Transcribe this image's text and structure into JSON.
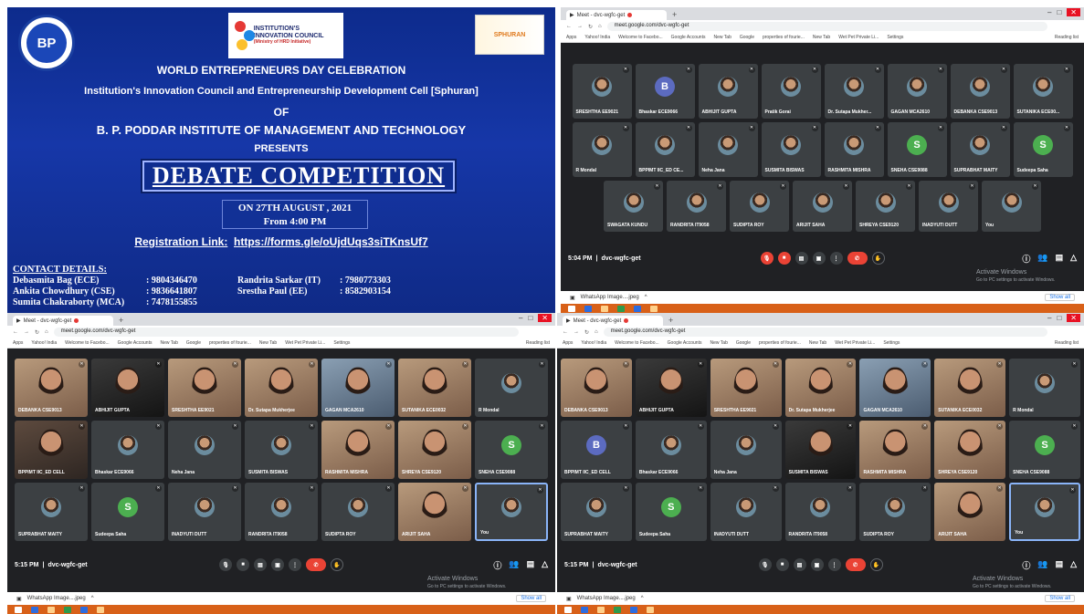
{
  "poster": {
    "bp_logo_text": "BP",
    "bp_logo_sub": "PODDAR",
    "iic_logo_text": "INSTITUTION'S INNOVATION COUNCIL",
    "iic_logo_sub": "(Ministry of HRD Initiative)",
    "sphuran_logo_text": "SPHURAN",
    "line1": "WORLD ENTREPRENEURS DAY CELEBRATION",
    "line2": "Institution's Innovation Council and Entrepreneurship Development Cell [Sphuran]",
    "line3": "OF",
    "line4": "B. P. PODDAR INSTITUTE OF MANAGEMENT AND TECHNOLOGY",
    "line5": "PRESENTS",
    "title": "DEBATE COMPETITION",
    "date": "ON 27TH AUGUST , 2021",
    "time": "From 4:00 PM",
    "reg_label": "Registration Link:",
    "reg_link": "https://forms.gle/oUjdUqs3siTKnsUf7",
    "contacts_heading": "CONTACT DETAILS:",
    "contacts": [
      {
        "name": "Debasmita Bag (ECE)",
        "phone": ": 9804346470",
        "name2": "Randrita Sarkar (IT)",
        "phone2": ": 7980773303"
      },
      {
        "name": "Ankita Chowdhury (CSE)",
        "phone": ": 9836641807",
        "name2": "Srestha Paul (EE)",
        "phone2": ": 8582903154"
      },
      {
        "name": "Sumita Chakraborty (MCA)",
        "phone": ": 7478155855",
        "name2": "",
        "phone2": ""
      }
    ]
  },
  "browser": {
    "tab_title": "Meet - dvc-wgfc-get",
    "url": "meet.google.com/dvc-wgfc-get",
    "bookmarks": [
      "Apps",
      "Yahoo! India",
      "Welcome to Facebo...",
      "Google Accounts",
      "New Tab",
      "Google",
      "properties of fourie...",
      "New Tab",
      "Wet Pet Private Li...",
      "Settings"
    ],
    "reading_list": "Reading list",
    "meeting_code": "dvc-wgfc-get",
    "download_file": "WhatsApp Image....jpeg",
    "show_all": "Show all",
    "activate_title": "Activate Windows",
    "activate_sub": "Go to PC settings to activate Windows."
  },
  "shot_top_right": {
    "time": "5:04 PM",
    "rows": [
      [
        "SRESHTHA EE9021",
        "Bhaskar ECE9066",
        "ABHIJIT GUPTA",
        "Pratik Gorai",
        "Dr. Sutapa Mukher...",
        "GAGAN MCA2610",
        "DEBANKA CSE9013",
        "SUTANIKA ECE00..."
      ],
      [
        "R Mondal",
        "BPPIMT IIC_ED CE...",
        "Neha Jana",
        "SUSMITA BISWAS",
        "RASHMITA MISHRA",
        "SNEHA CSE9088",
        "SUPRABHAT MAITY",
        "Sudeepa Saha"
      ],
      [
        "SWAGATA KUNDU",
        "RANDRITA IT9058",
        "SUDIPTA ROY",
        "ARIJIT SAHA",
        "SHREYA CSE9120",
        "INADYUTI DUTT",
        "You"
      ]
    ],
    "letters": {
      "1": "B",
      "13": "S",
      "15": "S"
    }
  },
  "shot_bottom_left": {
    "time": "5:15 PM",
    "rows": [
      [
        "DEBANKA CSE9013",
        "ABHIJIT GUPTA",
        "SRESHTHA EE9021",
        "Dr. Sutapa Mukherjee",
        "GAGAN MCA2610",
        "SUTANIKA ECE0032",
        "R Mondal"
      ],
      [
        "BPPIMT IIC_ED CELL",
        "Bhaskar ECE9066",
        "Neha Jana",
        "SUSMITA BISWAS",
        "RASHMITA MISHRA",
        "SHREYA CSE9120",
        "SNEHA CSE9088"
      ],
      [
        "SUPRABHAT MAITY",
        "Sudeepa Saha",
        "INADYUTI DUTT",
        "RANDRITA IT9058",
        "SUDIPTA ROY",
        "ARIJIT SAHA",
        "You"
      ]
    ],
    "letters": {
      "13": "S",
      "15": "S"
    }
  },
  "shot_bottom_right": {
    "time": "5:15 PM",
    "rows": [
      [
        "DEBANKA CSE9013",
        "ABHIJIT GUPTA",
        "SRESHTHA EE9021",
        "Dr. Sutapa Mukherjee",
        "GAGAN MCA2610",
        "SUTANIKA ECE0032",
        "R Mondal"
      ],
      [
        "BPPIMT IIC_ED CELL",
        "Bhaskar ECE9066",
        "Neha Jana",
        "SUSMITA BISWAS",
        "RASHMITA MISHRA",
        "SHREYA CSE9120",
        "SNEHA CSE9088"
      ],
      [
        "SUPRABHAT MAITY",
        "Sudeepa Saha",
        "INADYUTI DUTT",
        "RANDRITA IT9058",
        "SUDIPTA ROY",
        "ARIJIT SAHA",
        "You"
      ]
    ],
    "letters": {
      "7": "B",
      "13": "S",
      "15": "S"
    }
  },
  "colors": {
    "poster_bg": "#1637a8",
    "meet_bg": "#202124",
    "end_call": "#ea4335",
    "taskbar": "#d86018"
  }
}
